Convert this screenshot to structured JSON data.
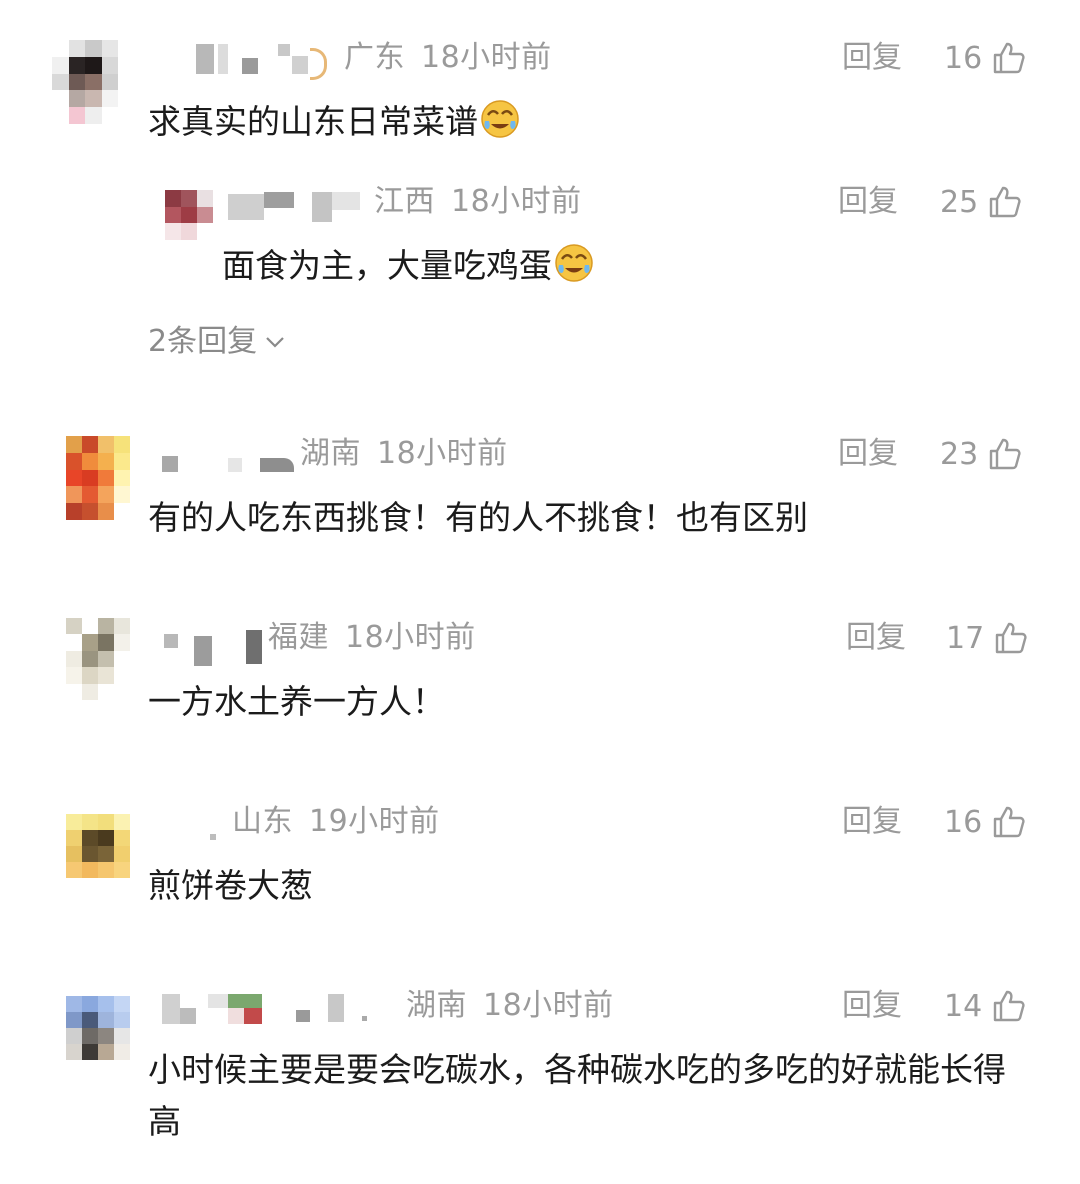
{
  "reply_label": "回复",
  "comments": [
    {
      "location": "广东",
      "time": "18小时前",
      "likes": "16",
      "text": "求真实的山东日常菜谱",
      "emoji": "face-with-tears-icon",
      "reply": {
        "location": "江西",
        "time": "18小时前",
        "likes": "25",
        "text": "面食为主，大量吃鸡蛋",
        "emoji": "face-with-tears-icon"
      },
      "more_replies": "2条回复"
    },
    {
      "location": "湖南",
      "time": "18小时前",
      "likes": "23",
      "text": "有的人吃东西挑食！有的人不挑食！也有区别"
    },
    {
      "location": "福建",
      "time": "18小时前",
      "likes": "17",
      "text": "一方水土养一方人！"
    },
    {
      "location": "山东",
      "time": "19小时前",
      "likes": "16",
      "text": "煎饼卷大葱"
    },
    {
      "location": "湖南",
      "time": "18小时前",
      "likes": "14",
      "text": "小时候主要是要会吃碳水，各种碳水吃的多吃的好就能长得高"
    }
  ],
  "colors": {
    "meta_text": "#9a9a9a",
    "body_text": "#1b1b1b",
    "emoji_face": "#f6c543"
  }
}
